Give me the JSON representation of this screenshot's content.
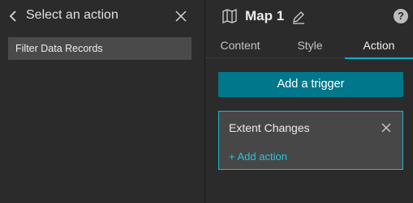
{
  "left_panel": {
    "title": "Select an action",
    "items": [
      {
        "label": "Filter Data Records"
      }
    ]
  },
  "right_panel": {
    "widget_name": "Map 1",
    "help_label": "?",
    "tabs": [
      {
        "label": "Content",
        "active": false
      },
      {
        "label": "Style",
        "active": false
      },
      {
        "label": "Action",
        "active": true
      }
    ],
    "add_trigger_label": "Add a trigger",
    "trigger": {
      "name": "Extent Changes",
      "add_action_label": "+ Add action"
    }
  },
  "colors": {
    "background": "#2b2b2b",
    "accent": "#00778a",
    "accent_border": "#1cb6cc",
    "link": "#24c6de",
    "tab_underline": "#00b3cc",
    "selected_item_bg": "#4a4a4a"
  },
  "icons": {
    "back": "chevron-left-icon",
    "close": "close-icon",
    "map": "map-icon",
    "edit": "pencil-icon",
    "help": "help-circle-icon"
  }
}
